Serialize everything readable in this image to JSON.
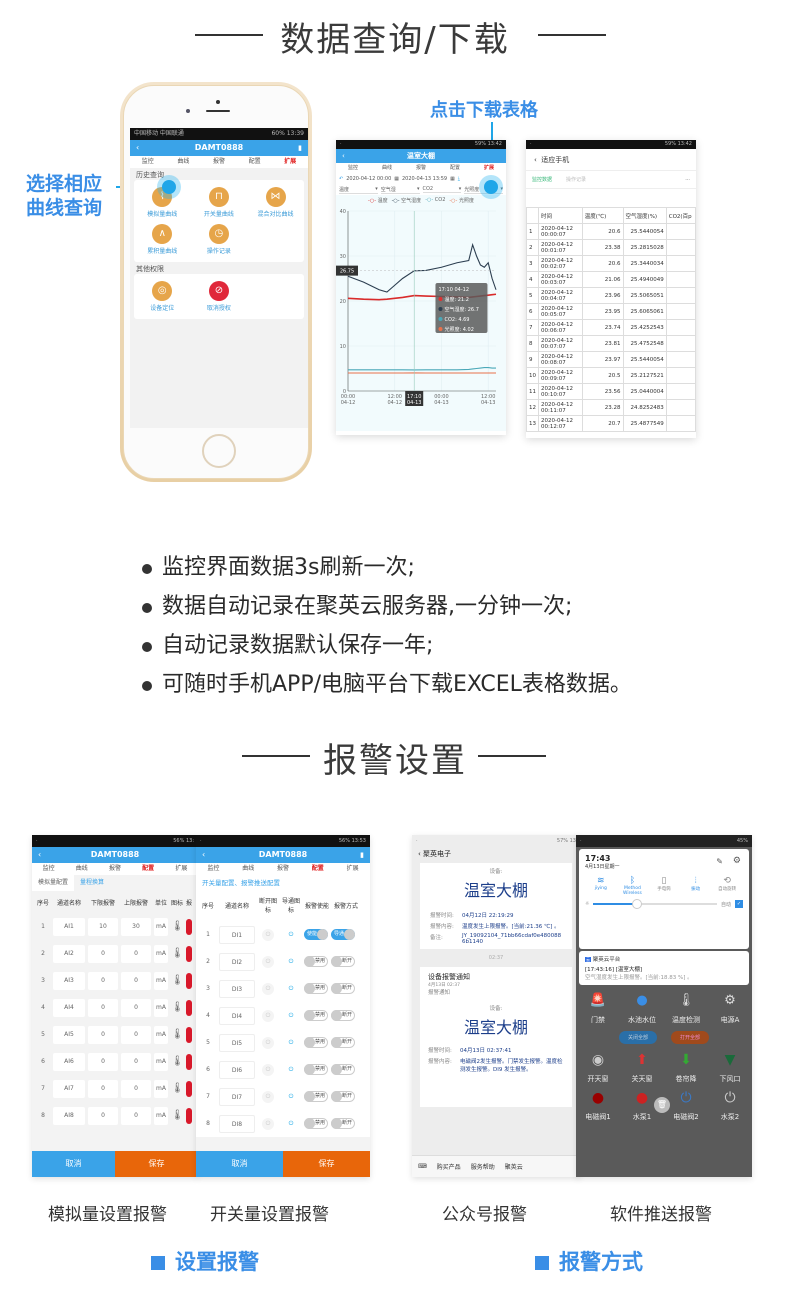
{
  "section1": {
    "title": "数据查询/下载",
    "callout_left": [
      "选择相应",
      "曲线查询"
    ],
    "callout_top": "点击下载表格"
  },
  "phone_app": {
    "status_left": "中国移动 中国联通",
    "status_right": "60% 13:39",
    "title": "DAMT0888",
    "tabs": [
      "监控",
      "曲线",
      "报警",
      "配置",
      "扩展"
    ],
    "active_tab": "扩展",
    "history_group": "历史查询",
    "history_items": [
      {
        "label": "模拟量曲线",
        "icon": "chart-line-icon"
      },
      {
        "label": "开关量曲线",
        "icon": "chart-step-icon"
      },
      {
        "label": "混合对比曲线",
        "icon": "chart-compare-icon"
      },
      {
        "label": "累积量曲线",
        "icon": "chart-area-icon"
      },
      {
        "label": "操作记录",
        "icon": "clock-icon"
      }
    ],
    "other_group": "其他权限",
    "other_items": [
      {
        "label": "设备定位",
        "icon": "location-icon"
      },
      {
        "label": "取消授权",
        "icon": "unauthorize-icon"
      }
    ]
  },
  "chart_screen": {
    "status_right": "59% 13:42",
    "title": "温室大棚",
    "tabs": [
      "监控",
      "曲线",
      "报警",
      "配置",
      "扩展"
    ],
    "start_time": "2020-04-12 00:00",
    "end_time": "2020-04-13 13:59",
    "selects": [
      "温度",
      "空气湿",
      "CO2",
      "光照度"
    ],
    "cursor_label": "26.75",
    "x_highlight": [
      "17:10",
      "04-13"
    ],
    "tooltip": {
      "time": "17:10 04-12",
      "rows": [
        {
          "name": "温度",
          "value": "21.2",
          "color": "#e03030"
        },
        {
          "name": "空气湿度",
          "value": "26.7",
          "color": "#2c3e50"
        },
        {
          "name": "CO2",
          "value": "4.69",
          "color": "#4aa8b8"
        },
        {
          "name": "光照度",
          "value": "4.02",
          "color": "#e8704a"
        }
      ]
    }
  },
  "chart_data": {
    "type": "line",
    "title": "",
    "xlabel": "",
    "ylabel": "",
    "ylim": [
      0,
      40
    ],
    "yticks": [
      "0",
      "10",
      "20",
      "30",
      "40"
    ],
    "xticks": [
      [
        "00:00",
        "04-12"
      ],
      [
        "12:00",
        "04-12"
      ],
      [
        "00:00",
        "04-13"
      ],
      [
        "12:00",
        "04-13"
      ]
    ],
    "legend": [
      "温度",
      "空气湿度",
      "CO2",
      "光照度"
    ],
    "legend_position": "top",
    "x": [
      0,
      4,
      8,
      10,
      12,
      14,
      17,
      20,
      24,
      28,
      31,
      32,
      33,
      34,
      35,
      36,
      37,
      38
    ],
    "series": [
      {
        "name": "温度",
        "color": "#d92b2b",
        "values": [
          20.6,
          20.4,
          20.3,
          20.4,
          20.6,
          20.8,
          21.2,
          21.1,
          21.0,
          20.9,
          20.8,
          20.9,
          21.0,
          21.1,
          21.2,
          21.3,
          21.4,
          21.5
        ]
      },
      {
        "name": "空气湿度",
        "color": "#2c3e50",
        "values": [
          25.5,
          24.2,
          22.5,
          22.0,
          23.5,
          25.0,
          26.7,
          26.8,
          27.5,
          28.5,
          29.0,
          32.5,
          30.0,
          28.0,
          27.5,
          28.5,
          25.0,
          22.5
        ]
      },
      {
        "name": "CO2",
        "color": "#4aa8b8",
        "values": [
          4.7,
          4.7,
          4.7,
          4.7,
          4.7,
          4.7,
          4.69,
          4.7,
          4.7,
          4.7,
          4.8,
          4.9,
          5.0,
          5.1,
          5.2,
          5.2,
          5.1,
          5.1
        ]
      },
      {
        "name": "光照度",
        "color": "#e8704a",
        "values": [
          4.0,
          4.0,
          4.0,
          4.0,
          4.0,
          4.0,
          4.02,
          4.0,
          4.0,
          4.0,
          4.0,
          4.0,
          4.0,
          4.0,
          4.0,
          4.0,
          4.0,
          4.0
        ]
      }
    ]
  },
  "table_screen": {
    "status_right": "59% 13:42",
    "title": "适应手机",
    "tabs": [
      "监控数据",
      "操作记录"
    ],
    "more": "···",
    "columns": [
      "",
      "时间",
      "温度(℃)",
      "空气湿度(%)",
      "CO2(百p"
    ],
    "rows": [
      [
        "1",
        "2020-04-12 00:00:07",
        "20.6",
        "25.5440054"
      ],
      [
        "2",
        "2020-04-12 00:01:07",
        "23.38",
        "25.2815028"
      ],
      [
        "3",
        "2020-04-12 00:02:07",
        "20.6",
        "25.3440034"
      ],
      [
        "4",
        "2020-04-12 00:03:07",
        "21.06",
        "25.4940049"
      ],
      [
        "5",
        "2020-04-12 00:04:07",
        "23.96",
        "25.5065051"
      ],
      [
        "6",
        "2020-04-12 00:05:07",
        "23.95",
        "25.6065061"
      ],
      [
        "7",
        "2020-04-12 00:06:07",
        "23.74",
        "25.4252543"
      ],
      [
        "8",
        "2020-04-12 00:07:07",
        "23.81",
        "25.4752548"
      ],
      [
        "9",
        "2020-04-12 00:08:07",
        "23.97",
        "25.5440054"
      ],
      [
        "10",
        "2020-04-12 00:09:07",
        "20.5",
        "25.2127521"
      ],
      [
        "11",
        "2020-04-12 00:10:07",
        "23.56",
        "25.0440004"
      ],
      [
        "12",
        "2020-04-12 00:11:07",
        "23.28",
        "24.8252483"
      ],
      [
        "13",
        "2020-04-12 00:12:07",
        "20.7",
        "25.4877549"
      ]
    ]
  },
  "bullets": [
    "监控界面数据3s刷新一次;",
    "数据自动记录在聚英云服务器,一分钟一次;",
    "自动记录数据默认保存一年;",
    "可随时手机APP/电脑平台下载EXCEL表格数据。"
  ],
  "section2": {
    "title": "报警设置"
  },
  "analog_screen": {
    "status_right": "56% 13:",
    "title": "DAMT0888",
    "tabs": [
      "监控",
      "曲线",
      "报警",
      "配置",
      "扩展"
    ],
    "subtabs": [
      "模拟量配置",
      "量程换算"
    ],
    "columns": [
      "序号",
      "通道名称",
      "下限报警",
      "上限报警",
      "单位",
      "图标",
      "报"
    ],
    "rows": [
      [
        "1",
        "AI1",
        "10",
        "30",
        "mA"
      ],
      [
        "2",
        "AI2",
        "0",
        "0",
        "mA"
      ],
      [
        "3",
        "AI3",
        "0",
        "0",
        "mA"
      ],
      [
        "4",
        "AI4",
        "0",
        "0",
        "mA"
      ],
      [
        "5",
        "AI5",
        "0",
        "0",
        "mA"
      ],
      [
        "6",
        "AI6",
        "0",
        "0",
        "mA"
      ],
      [
        "7",
        "AI7",
        "0",
        "0",
        "mA"
      ],
      [
        "8",
        "AI8",
        "0",
        "0",
        "mA"
      ]
    ],
    "cancel": "取消",
    "save": "保存"
  },
  "digital_screen": {
    "status_right": "56% 13:53",
    "title": "DAMT0888",
    "tabs": [
      "监控",
      "曲线",
      "报警",
      "配置",
      "扩展"
    ],
    "heading": "开关量配置、报警推送配置",
    "columns": [
      "序号",
      "通道名称",
      "断开图标",
      "导通图标",
      "报警使能",
      "报警方式"
    ],
    "rows": [
      {
        "no": "1",
        "name": "DI1",
        "enable": "使能",
        "mode": "导通",
        "on": true
      },
      {
        "no": "2",
        "name": "DI2",
        "enable": "禁用",
        "mode": "断开",
        "on": false
      },
      {
        "no": "3",
        "name": "DI3",
        "enable": "禁用",
        "mode": "断开",
        "on": false
      },
      {
        "no": "4",
        "name": "DI4",
        "enable": "禁用",
        "mode": "断开",
        "on": false
      },
      {
        "no": "5",
        "name": "DI5",
        "enable": "禁用",
        "mode": "断开",
        "on": false
      },
      {
        "no": "6",
        "name": "DI6",
        "enable": "禁用",
        "mode": "断开",
        "on": false
      },
      {
        "no": "7",
        "name": "DI7",
        "enable": "禁用",
        "mode": "断开",
        "on": false
      },
      {
        "no": "8",
        "name": "DI8",
        "enable": "禁用",
        "mode": "断开",
        "on": false
      }
    ],
    "cancel": "取消",
    "save": "保存"
  },
  "wechat_screen": {
    "status_right": "57% 13",
    "account": "聚英电子",
    "card1": {
      "device_label": "设备:",
      "device": "温室大棚",
      "time_label": "报警时间:",
      "time": "04月12日 22:19:29",
      "content_label": "报警内容:",
      "content": "温度发生上限报警。[当前:21.36 ℃] 。",
      "note_label": "备注:",
      "note": "JY_19092104_71bb66cdaf0e4800886b1140"
    },
    "divider_time": "02:37",
    "card2": {
      "title": "设备报警通知",
      "date": "4月13日 02:37",
      "sub": "报警通知",
      "device_label": "设备:",
      "device": "温室大棚",
      "time_label": "报警时间:",
      "time": "04月13日 02:37:41",
      "content_label": "报警内容:",
      "content": "电磁阀2发生报警。门禁发生报警。温度检测发生报警。DI9 发生报警。"
    },
    "menu": [
      "购买产品",
      "服务帮助",
      "聚英云"
    ]
  },
  "push_screen": {
    "status_right": "45%",
    "time": "17:43",
    "date": "4月13日星期一",
    "quick": [
      {
        "label": "jiying",
        "icon": "wifi-icon",
        "active": true
      },
      {
        "label": "Method Wireless",
        "icon": "bluetooth-icon",
        "active": true
      },
      {
        "label": "手电筒",
        "icon": "flashlight-icon",
        "active": false
      },
      {
        "label": "振动",
        "icon": "vibrate-icon",
        "active": true
      },
      {
        "label": "自动旋转",
        "icon": "rotate-icon",
        "active": false
      }
    ],
    "brightness_auto": "自动",
    "brightness": 0.35,
    "notif_app": "聚英云平台",
    "notif_title": "[17:43:16] [温室大棚]",
    "notif_body": "空气湿度发生上限报警。[当前:18.83 %] 。",
    "devices": [
      "门禁",
      "水池水位",
      "温度检测",
      "电源A"
    ],
    "off_all": "关闭全部",
    "on_all": "打开全部",
    "controls": [
      "开天窗",
      "关天窗",
      "卷帘降",
      "下风口",
      "电磁阀1",
      "水泵1",
      "电磁阀2",
      "水泵2"
    ],
    "corner_tag": "通知图标"
  },
  "captions": [
    "模拟量设置报警",
    "开关量设置报警",
    "公众号报警",
    "软件推送报警"
  ],
  "footers": [
    "设置报警",
    "报警方式"
  ]
}
